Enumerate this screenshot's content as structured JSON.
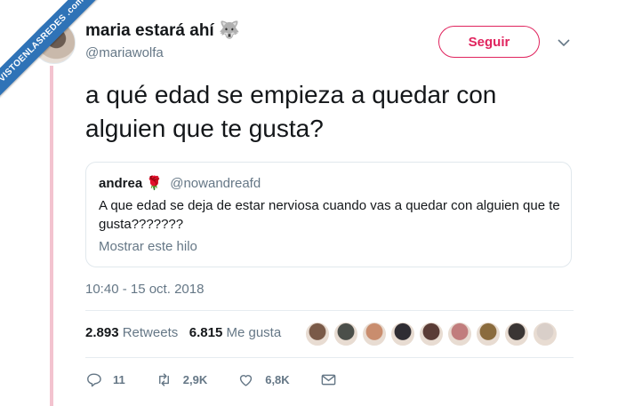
{
  "watermark": {
    "text": "VISTOENLASREDES .com"
  },
  "author": {
    "name": "maria estará ahí",
    "name_emoji": "🐺",
    "handle": "@mariawolfa"
  },
  "follow_button": {
    "label": "Seguir"
  },
  "tweet": {
    "text": "a qué edad se empieza a quedar con alguien que te gusta?",
    "timestamp": "10:40 - 15 oct. 2018"
  },
  "quoted_tweet": {
    "name": "andrea",
    "emoji": "🌹",
    "handle": "@nowandreafd",
    "text": "A que edad se deja de estar nerviosa cuando vas a quedar con alguien que te gusta???????",
    "link": "Mostrar este hilo"
  },
  "stats": {
    "retweets_count": "2.893",
    "retweets_label": "Retweets",
    "likes_count": "6.815",
    "likes_label": "Me gusta",
    "liker_avatar_colors": [
      "#7a5a48",
      "#4b4f4a",
      "#c98d6e",
      "#2f2d33",
      "#5a3c36",
      "#c17d7d",
      "#8a6b3d",
      "#3a3534",
      "#d9cfc9"
    ]
  },
  "actions": {
    "reply_count": "11",
    "retweet_count": "2,9K",
    "like_count": "6,8K"
  },
  "colors": {
    "accent": "#e0245e",
    "secondary_text": "#657786",
    "thread_line": "#f3c3cf",
    "ribbon": "#2f73b7"
  }
}
